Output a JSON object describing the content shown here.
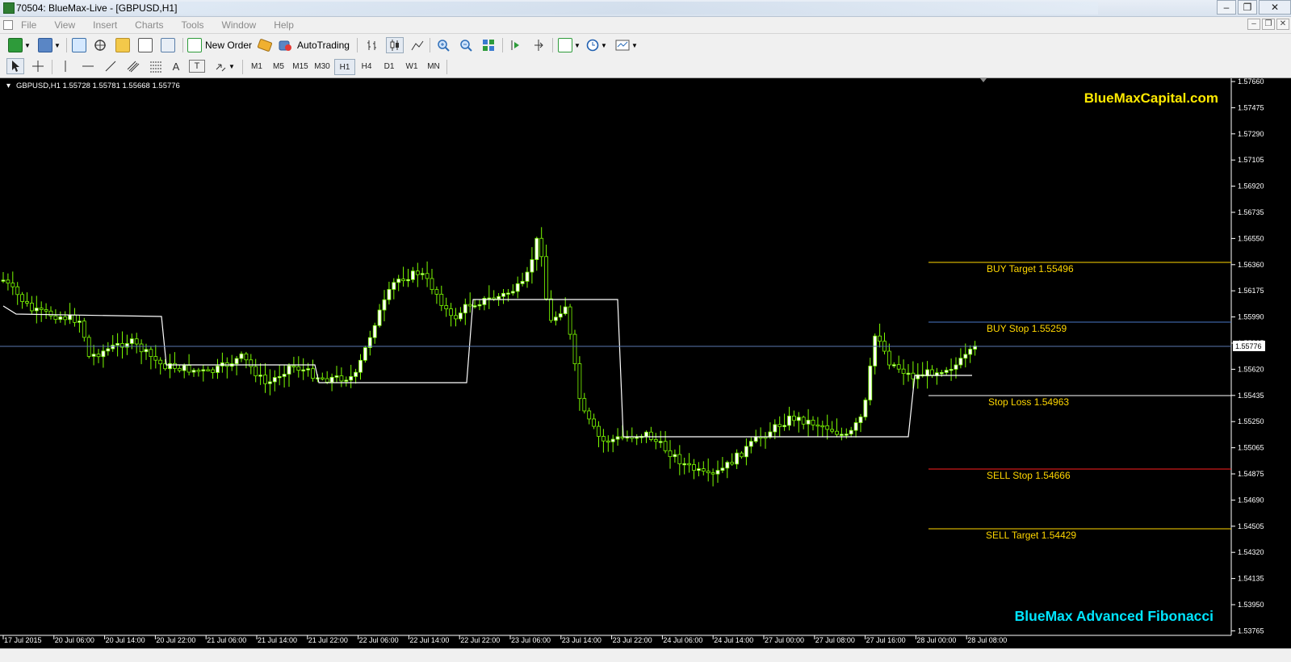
{
  "window": {
    "title": "70504: BlueMax-Live - [GBPUSD,H1]",
    "controls": [
      "–",
      "❐",
      "✕"
    ]
  },
  "menu": {
    "items": [
      "File",
      "View",
      "Insert",
      "Charts",
      "Tools",
      "Window",
      "Help"
    ]
  },
  "toolbar": {
    "new_order": "New Order",
    "auto_trading": "AutoTrading",
    "icons": [
      "new-chart-icon",
      "profiles-icon",
      "market-watch-icon",
      "navigator-icon",
      "data-window-icon",
      "terminal-icon",
      "strategy-tester-icon",
      "new-order-icon",
      "metaeditor-icon",
      "autotrading-icon",
      "bar-chart-icon",
      "candlestick-icon",
      "line-chart-icon",
      "zoom-in-icon",
      "zoom-out-icon",
      "tile-windows-icon",
      "autoscroll-icon",
      "chart-shift-icon",
      "indicators-icon",
      "periods-icon",
      "templates-icon"
    ],
    "search_icon": "search-icon"
  },
  "tools": {
    "icons": [
      "cursor-icon",
      "crosshair-icon",
      "vertical-line-icon",
      "horizontal-line-icon",
      "trendline-icon",
      "equidistant-channel-icon",
      "fibonacci-icon",
      "text-icon",
      "text-label-icon",
      "arrows-icon"
    ],
    "text_letter": "A",
    "label_letter": "T"
  },
  "timeframes": {
    "items": [
      "M1",
      "M5",
      "M15",
      "M30",
      "H1",
      "H4",
      "D1",
      "W1",
      "MN"
    ],
    "active": "H1"
  },
  "chart": {
    "header": "GBPUSD,H1  1.55728 1.55781 1.55668 1.55776",
    "watermark_top": "BlueMaxCapital.com",
    "watermark_bottom": "BlueMax Advanced Fibonacci",
    "current_price": "1.55776",
    "colors": {
      "background": "#000000",
      "bull": "#7cfc00",
      "level_yellow": "#ffd700",
      "level_blue": "#4a78c8",
      "level_red": "#ff2020",
      "level_white": "#ffffff",
      "brand_yellow": "#ffea00",
      "brand_cyan": "#00e5ff"
    },
    "levels": [
      {
        "label": "BUY Target  1.55496",
        "color": "#ffd700"
      },
      {
        "label": "BUY Stop    1.55259",
        "color": "#4a78c8"
      },
      {
        "label": "Stop Loss   1.54963",
        "color": "#ffffff"
      },
      {
        "label": "SELL Stop   1.54666",
        "color": "#ff2020"
      },
      {
        "label": "SELL Target 1.54429",
        "color": "#ffd700"
      }
    ],
    "price_axis": [
      "1.57660",
      "1.57475",
      "1.57290",
      "1.57105",
      "1.56920",
      "1.56735",
      "1.56550",
      "1.56360",
      "1.56175",
      "1.55990",
      "1.55805",
      "1.55620",
      "1.55435",
      "1.55250",
      "1.55065",
      "1.54875",
      "1.54690",
      "1.54505",
      "1.54320",
      "1.54135",
      "1.53950",
      "1.53765"
    ],
    "time_axis": [
      "17 Jul 2015",
      "20 Jul 06:00",
      "20 Jul 14:00",
      "20 Jul 22:00",
      "21 Jul 06:00",
      "21 Jul 14:00",
      "21 Jul 22:00",
      "22 Jul 06:00",
      "22 Jul 14:00",
      "22 Jul 22:00",
      "23 Jul 06:00",
      "23 Jul 14:00",
      "23 Jul 22:00",
      "24 Jul 06:00",
      "24 Jul 14:00",
      "27 Jul 00:00",
      "27 Jul 08:00",
      "27 Jul 16:00",
      "28 Jul 00:00",
      "28 Jul 08:00"
    ]
  }
}
